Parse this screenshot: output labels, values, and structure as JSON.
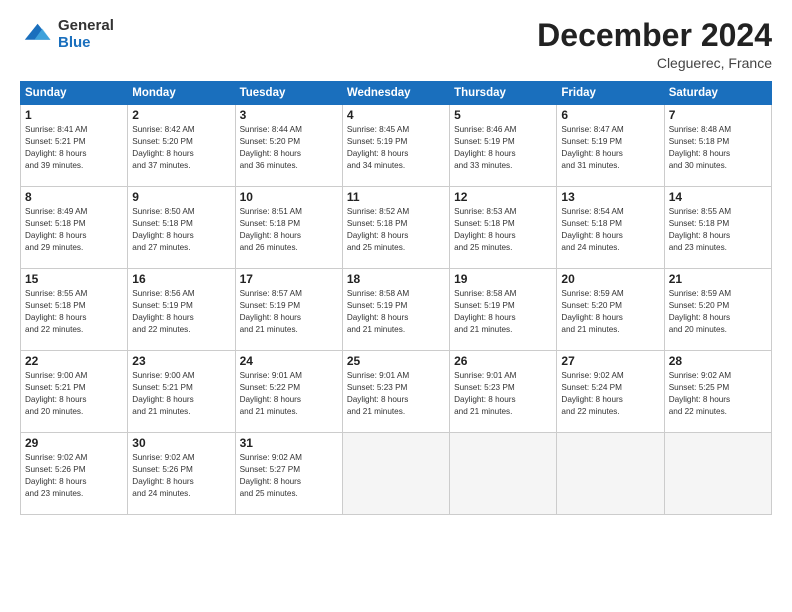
{
  "header": {
    "logo_general": "General",
    "logo_blue": "Blue",
    "month_title": "December 2024",
    "location": "Cleguerec, France"
  },
  "days_of_week": [
    "Sunday",
    "Monday",
    "Tuesday",
    "Wednesday",
    "Thursday",
    "Friday",
    "Saturday"
  ],
  "weeks": [
    [
      {
        "day": "1",
        "lines": [
          "Sunrise: 8:41 AM",
          "Sunset: 5:21 PM",
          "Daylight: 8 hours",
          "and 39 minutes."
        ]
      },
      {
        "day": "2",
        "lines": [
          "Sunrise: 8:42 AM",
          "Sunset: 5:20 PM",
          "Daylight: 8 hours",
          "and 37 minutes."
        ]
      },
      {
        "day": "3",
        "lines": [
          "Sunrise: 8:44 AM",
          "Sunset: 5:20 PM",
          "Daylight: 8 hours",
          "and 36 minutes."
        ]
      },
      {
        "day": "4",
        "lines": [
          "Sunrise: 8:45 AM",
          "Sunset: 5:19 PM",
          "Daylight: 8 hours",
          "and 34 minutes."
        ]
      },
      {
        "day": "5",
        "lines": [
          "Sunrise: 8:46 AM",
          "Sunset: 5:19 PM",
          "Daylight: 8 hours",
          "and 33 minutes."
        ]
      },
      {
        "day": "6",
        "lines": [
          "Sunrise: 8:47 AM",
          "Sunset: 5:19 PM",
          "Daylight: 8 hours",
          "and 31 minutes."
        ]
      },
      {
        "day": "7",
        "lines": [
          "Sunrise: 8:48 AM",
          "Sunset: 5:18 PM",
          "Daylight: 8 hours",
          "and 30 minutes."
        ]
      }
    ],
    [
      {
        "day": "8",
        "lines": [
          "Sunrise: 8:49 AM",
          "Sunset: 5:18 PM",
          "Daylight: 8 hours",
          "and 29 minutes."
        ]
      },
      {
        "day": "9",
        "lines": [
          "Sunrise: 8:50 AM",
          "Sunset: 5:18 PM",
          "Daylight: 8 hours",
          "and 27 minutes."
        ]
      },
      {
        "day": "10",
        "lines": [
          "Sunrise: 8:51 AM",
          "Sunset: 5:18 PM",
          "Daylight: 8 hours",
          "and 26 minutes."
        ]
      },
      {
        "day": "11",
        "lines": [
          "Sunrise: 8:52 AM",
          "Sunset: 5:18 PM",
          "Daylight: 8 hours",
          "and 25 minutes."
        ]
      },
      {
        "day": "12",
        "lines": [
          "Sunrise: 8:53 AM",
          "Sunset: 5:18 PM",
          "Daylight: 8 hours",
          "and 25 minutes."
        ]
      },
      {
        "day": "13",
        "lines": [
          "Sunrise: 8:54 AM",
          "Sunset: 5:18 PM",
          "Daylight: 8 hours",
          "and 24 minutes."
        ]
      },
      {
        "day": "14",
        "lines": [
          "Sunrise: 8:55 AM",
          "Sunset: 5:18 PM",
          "Daylight: 8 hours",
          "and 23 minutes."
        ]
      }
    ],
    [
      {
        "day": "15",
        "lines": [
          "Sunrise: 8:55 AM",
          "Sunset: 5:18 PM",
          "Daylight: 8 hours",
          "and 22 minutes."
        ]
      },
      {
        "day": "16",
        "lines": [
          "Sunrise: 8:56 AM",
          "Sunset: 5:19 PM",
          "Daylight: 8 hours",
          "and 22 minutes."
        ]
      },
      {
        "day": "17",
        "lines": [
          "Sunrise: 8:57 AM",
          "Sunset: 5:19 PM",
          "Daylight: 8 hours",
          "and 21 minutes."
        ]
      },
      {
        "day": "18",
        "lines": [
          "Sunrise: 8:58 AM",
          "Sunset: 5:19 PM",
          "Daylight: 8 hours",
          "and 21 minutes."
        ]
      },
      {
        "day": "19",
        "lines": [
          "Sunrise: 8:58 AM",
          "Sunset: 5:19 PM",
          "Daylight: 8 hours",
          "and 21 minutes."
        ]
      },
      {
        "day": "20",
        "lines": [
          "Sunrise: 8:59 AM",
          "Sunset: 5:20 PM",
          "Daylight: 8 hours",
          "and 21 minutes."
        ]
      },
      {
        "day": "21",
        "lines": [
          "Sunrise: 8:59 AM",
          "Sunset: 5:20 PM",
          "Daylight: 8 hours",
          "and 20 minutes."
        ]
      }
    ],
    [
      {
        "day": "22",
        "lines": [
          "Sunrise: 9:00 AM",
          "Sunset: 5:21 PM",
          "Daylight: 8 hours",
          "and 20 minutes."
        ]
      },
      {
        "day": "23",
        "lines": [
          "Sunrise: 9:00 AM",
          "Sunset: 5:21 PM",
          "Daylight: 8 hours",
          "and 21 minutes."
        ]
      },
      {
        "day": "24",
        "lines": [
          "Sunrise: 9:01 AM",
          "Sunset: 5:22 PM",
          "Daylight: 8 hours",
          "and 21 minutes."
        ]
      },
      {
        "day": "25",
        "lines": [
          "Sunrise: 9:01 AM",
          "Sunset: 5:23 PM",
          "Daylight: 8 hours",
          "and 21 minutes."
        ]
      },
      {
        "day": "26",
        "lines": [
          "Sunrise: 9:01 AM",
          "Sunset: 5:23 PM",
          "Daylight: 8 hours",
          "and 21 minutes."
        ]
      },
      {
        "day": "27",
        "lines": [
          "Sunrise: 9:02 AM",
          "Sunset: 5:24 PM",
          "Daylight: 8 hours",
          "and 22 minutes."
        ]
      },
      {
        "day": "28",
        "lines": [
          "Sunrise: 9:02 AM",
          "Sunset: 5:25 PM",
          "Daylight: 8 hours",
          "and 22 minutes."
        ]
      }
    ],
    [
      {
        "day": "29",
        "lines": [
          "Sunrise: 9:02 AM",
          "Sunset: 5:26 PM",
          "Daylight: 8 hours",
          "and 23 minutes."
        ]
      },
      {
        "day": "30",
        "lines": [
          "Sunrise: 9:02 AM",
          "Sunset: 5:26 PM",
          "Daylight: 8 hours",
          "and 24 minutes."
        ]
      },
      {
        "day": "31",
        "lines": [
          "Sunrise: 9:02 AM",
          "Sunset: 5:27 PM",
          "Daylight: 8 hours",
          "and 25 minutes."
        ]
      },
      null,
      null,
      null,
      null
    ]
  ]
}
